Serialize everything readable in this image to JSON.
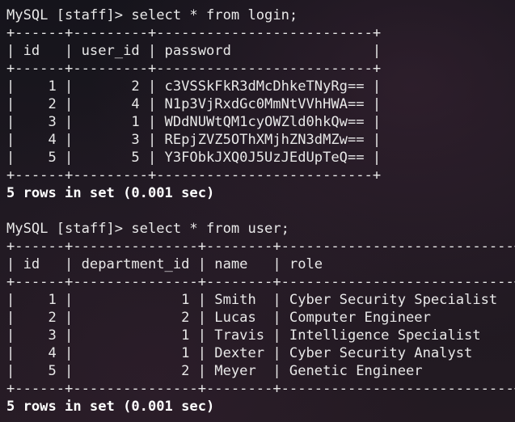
{
  "terminal": {
    "queries": [
      {
        "prompt": "MySQL [staff]> ",
        "command": "select * from login;",
        "border": "+------+---------+--------------------------+",
        "header": "| id   | user_id | password                 |",
        "rows": [
          "|    1 |       2 | c3VSSkFkR3dMcDhkeTNyRg== |",
          "|    2 |       4 | N1p3VjRxdGc0MmNtVVhHWA== |",
          "|    3 |       1 | WDdNUWtQM1cyOWZld0hkQw== |",
          "|    4 |       3 | REpjZVZ5OThXMjhZN3dMZw== |",
          "|    5 |       5 | Y3FObkJXQ0J5UzJEdUpTeQ== |"
        ],
        "summary": "5 rows in set (0.001 sec)"
      },
      {
        "prompt": "MySQL [staff]> ",
        "command": "select * from user;",
        "border": "+------+---------------+--------+----------------------------+",
        "header": "| id   | department_id | name   | role                       |",
        "rows": [
          "|    1 |             1 | Smith  | Cyber Security Specialist  |",
          "|    2 |             2 | Lucas  | Computer Engineer          |",
          "|    3 |             1 | Travis | Intelligence Specialist    |",
          "|    4 |             1 | Dexter | Cyber Security Analyst     |",
          "|    5 |             2 | Meyer  | Genetic Engineer           |"
        ],
        "summary": "5 rows in set (0.001 sec)"
      }
    ]
  }
}
